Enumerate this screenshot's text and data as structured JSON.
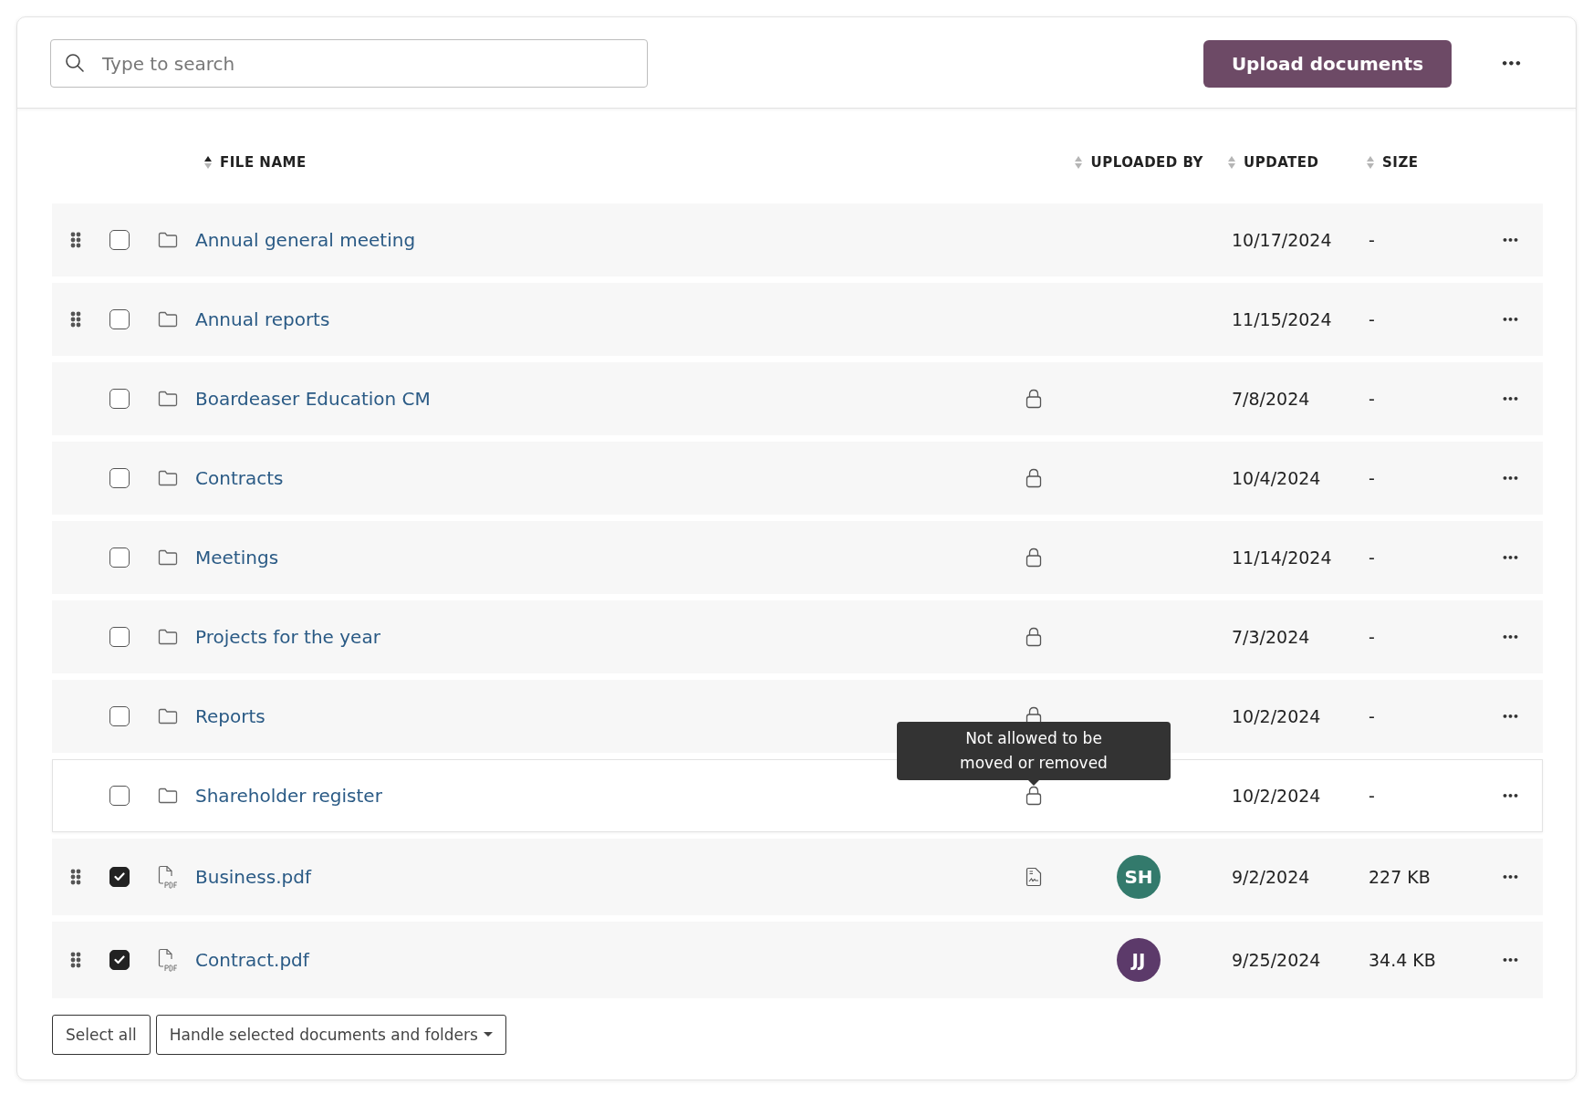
{
  "search": {
    "placeholder": "Type to search"
  },
  "upload_button": "Upload documents",
  "more_menu": "•••",
  "columns": [
    {
      "label": "FILE NAME",
      "sorted": true
    },
    {
      "label": "UPLOADED BY",
      "sorted": false
    },
    {
      "label": "UPDATED",
      "sorted": false
    },
    {
      "label": "SIZE",
      "sorted": false
    }
  ],
  "rows": [
    {
      "kind": "folder",
      "name": "Annual general meeting",
      "draggable": true,
      "checked": false,
      "hovered": false,
      "locked": false,
      "signed": false,
      "updated": "10/17/2024",
      "size": "-",
      "menu": "•••"
    },
    {
      "kind": "folder",
      "name": "Annual reports",
      "draggable": true,
      "checked": false,
      "hovered": false,
      "locked": false,
      "signed": false,
      "updated": "11/15/2024",
      "size": "-",
      "menu": "•••"
    },
    {
      "kind": "folder",
      "name": "Boardeaser Education CM",
      "draggable": false,
      "checked": false,
      "hovered": false,
      "locked": true,
      "signed": false,
      "updated": "7/8/2024",
      "size": "-",
      "menu": "•••"
    },
    {
      "kind": "folder",
      "name": "Contracts",
      "draggable": false,
      "checked": false,
      "hovered": false,
      "locked": true,
      "signed": false,
      "updated": "10/4/2024",
      "size": "-",
      "menu": "•••"
    },
    {
      "kind": "folder",
      "name": "Meetings",
      "draggable": false,
      "checked": false,
      "hovered": false,
      "locked": true,
      "signed": false,
      "updated": "11/14/2024",
      "size": "-",
      "menu": "•••"
    },
    {
      "kind": "folder",
      "name": "Projects for the year",
      "draggable": false,
      "checked": false,
      "hovered": false,
      "locked": true,
      "signed": false,
      "updated": "7/3/2024",
      "size": "-",
      "menu": "•••"
    },
    {
      "kind": "folder",
      "name": "Reports",
      "draggable": false,
      "checked": false,
      "hovered": false,
      "locked": true,
      "signed": false,
      "updated": "10/2/2024",
      "size": "-",
      "menu": "•••"
    },
    {
      "kind": "folder",
      "name": "Shareholder register",
      "draggable": false,
      "checked": false,
      "hovered": true,
      "locked": true,
      "signed": false,
      "tooltip": "Not allowed to be moved or removed",
      "updated": "10/2/2024",
      "size": "-",
      "menu": "•••"
    },
    {
      "kind": "pdf",
      "name": "Business.pdf",
      "draggable": true,
      "checked": true,
      "hovered": false,
      "locked": false,
      "signed": true,
      "uploader": {
        "initials": "SH",
        "color": "#337a6c"
      },
      "updated": "9/2/2024",
      "size": "227 KB",
      "menu": "•••"
    },
    {
      "kind": "pdf",
      "name": "Contract.pdf",
      "draggable": true,
      "checked": true,
      "hovered": false,
      "locked": false,
      "signed": false,
      "uploader": {
        "initials": "JJ",
        "color": "#5c3a6a"
      },
      "updated": "9/25/2024",
      "size": "34.4 KB",
      "menu": "•••"
    }
  ],
  "footer_buttons": [
    {
      "kind": "plain",
      "label": "Select all"
    },
    {
      "kind": "dropdown",
      "label": "Handle selected documents and folders"
    }
  ]
}
